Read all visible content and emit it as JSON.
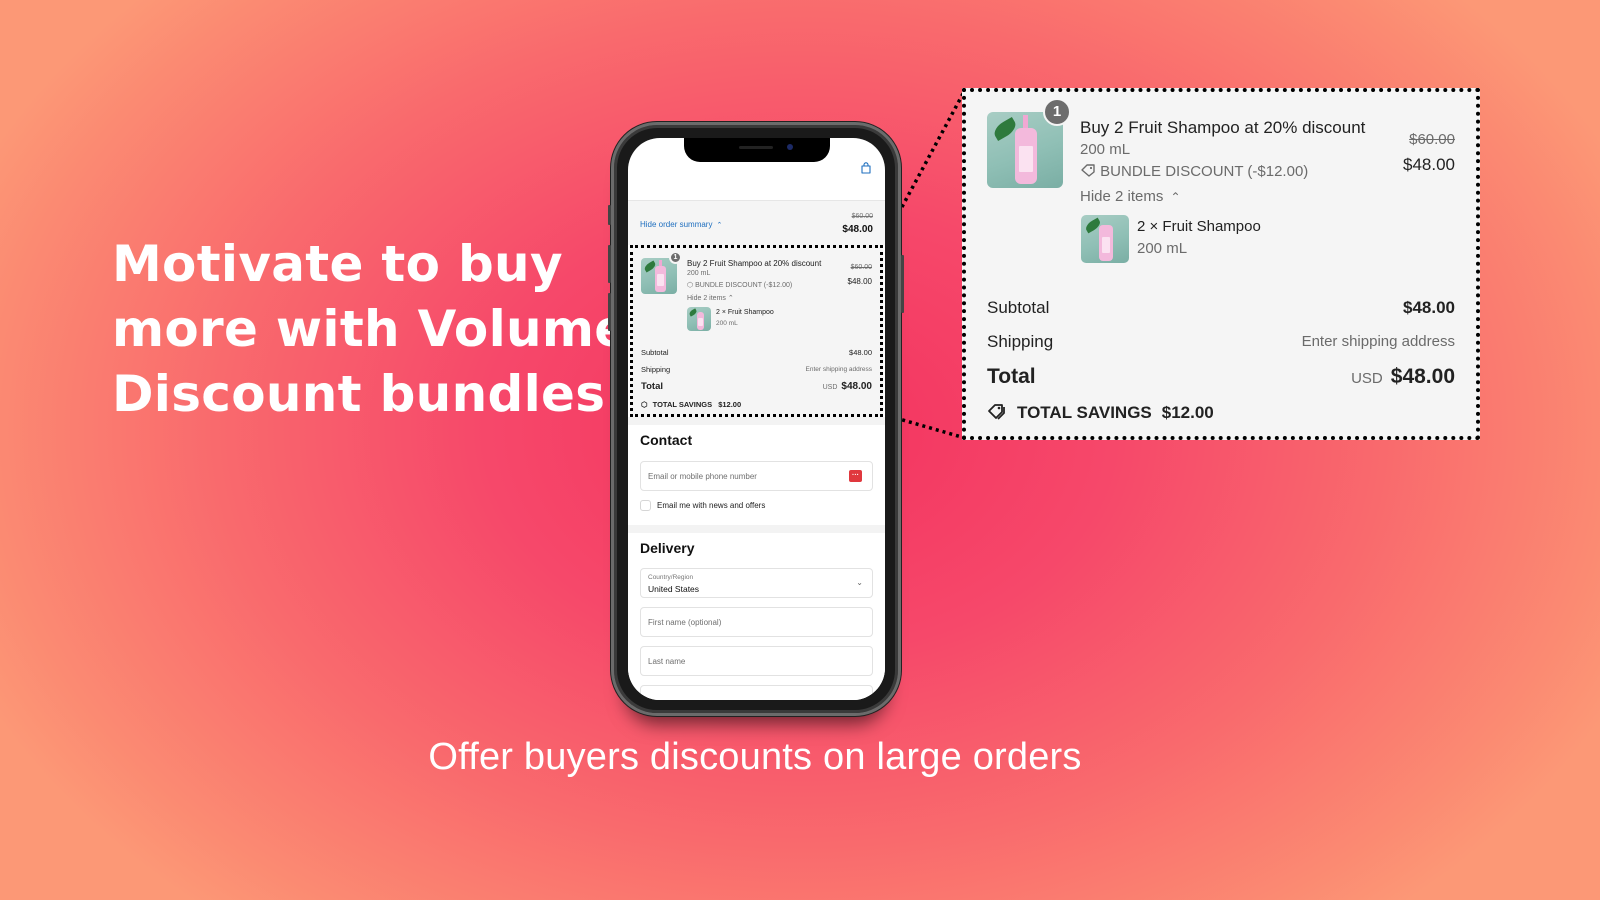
{
  "headline": {
    "lines": [
      "Motivate to buy",
      "more with Volume",
      "Discount bundles"
    ]
  },
  "subtitle": "Offer buyers discounts on large orders",
  "colors": {
    "background_center": "#f3325f",
    "background_edge": "#fc9876",
    "link_blue": "#1f6fbf",
    "badge_grey": "#6d6d6d",
    "password_icon_red": "#e0383e"
  },
  "phone": {
    "header": {
      "cart_icon": "shopping-bag-icon"
    },
    "summary_bar": {
      "toggle_label": "Hide order summary",
      "toggle_icon": "chevron-up-icon",
      "original_price": "$60.00",
      "price": "$48.00"
    },
    "order_summary": {
      "bundle": {
        "quantity_badge": "1",
        "title": "Buy 2 Fruit Shampoo at 20% discount",
        "variant": "200 mL",
        "discount_icon": "tag-icon",
        "discount_label": "BUNDLE DISCOUNT (-$12.00)",
        "original_price": "$60.00",
        "price": "$48.00",
        "toggle_items_label": "Hide 2 items",
        "toggle_items_icon": "chevron-up-icon",
        "items": [
          {
            "name": "2 × Fruit Shampoo",
            "variant": "200 mL"
          }
        ]
      },
      "subtotal_label": "Subtotal",
      "subtotal_value": "$48.00",
      "shipping_label": "Shipping",
      "shipping_value": "Enter shipping address",
      "total_label": "Total",
      "total_currency": "USD",
      "total_value": "$48.00",
      "savings_icon": "tags-icon",
      "savings_label": "TOTAL SAVINGS",
      "savings_value": "$12.00"
    },
    "contact": {
      "title": "Contact",
      "email_placeholder": "Email or mobile phone number",
      "password_manager_icon": "password-manager-icon",
      "newsletter_label": "Email me with news and offers",
      "newsletter_checked": false
    },
    "delivery": {
      "title": "Delivery",
      "country_label": "Country/Region",
      "country_value": "United States",
      "first_name_placeholder": "First name (optional)",
      "last_name_placeholder": "Last name"
    }
  },
  "zoomed_summary": {
    "quantity_badge": "1",
    "title": "Buy 2 Fruit Shampoo at 20% discount",
    "variant": "200 mL",
    "discount_label": "BUNDLE DISCOUNT (-$12.00)",
    "original_price": "$60.00",
    "price": "$48.00",
    "toggle_items_label": "Hide 2 items",
    "item_name": "2 × Fruit Shampoo",
    "item_variant": "200 mL",
    "subtotal_label": "Subtotal",
    "subtotal_value": "$48.00",
    "shipping_label": "Shipping",
    "shipping_value": "Enter shipping address",
    "total_label": "Total",
    "total_currency": "USD",
    "total_value": "$48.00",
    "savings_label": "TOTAL SAVINGS",
    "savings_value": "$12.00"
  }
}
